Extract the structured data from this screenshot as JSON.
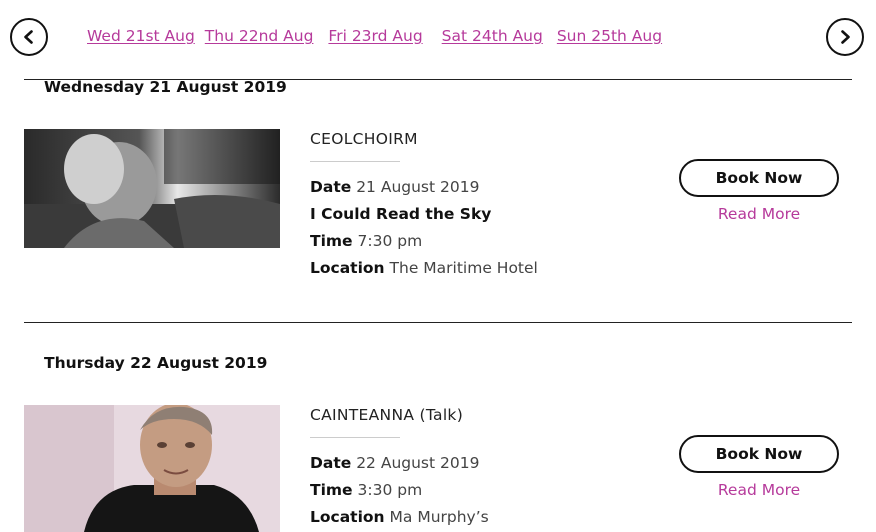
{
  "date_nav": {
    "links": [
      "Wed 21st Aug",
      "Thu 22nd Aug",
      "Fri 23rd Aug",
      "Sat 24th Aug",
      "Sun 25th Aug"
    ]
  },
  "days": [
    {
      "heading": "Wednesday 21 August 2019",
      "event": {
        "title": "CEOLCHOIRM",
        "date_label": "Date",
        "date_value": "21 August 2019",
        "subtitle": "I Could Read the Sky",
        "time_label": "Time",
        "time_value": "7:30 pm",
        "location_label": "Location",
        "location_value": "The Maritime Hotel",
        "book_label": "Book Now",
        "read_more_label": "Read More"
      }
    },
    {
      "heading": "Thursday 22 August 2019",
      "event": {
        "title": "CAINTEANNA (Talk)",
        "date_label": "Date",
        "date_value": "22 August 2019",
        "time_label": "Time",
        "time_value": "3:30 pm",
        "location_label": "Location",
        "location_value": "Ma Murphy’s",
        "book_label": "Book Now",
        "read_more_label": "Read More"
      }
    }
  ],
  "colors": {
    "link": "#b63a9b",
    "text": "#222222"
  }
}
